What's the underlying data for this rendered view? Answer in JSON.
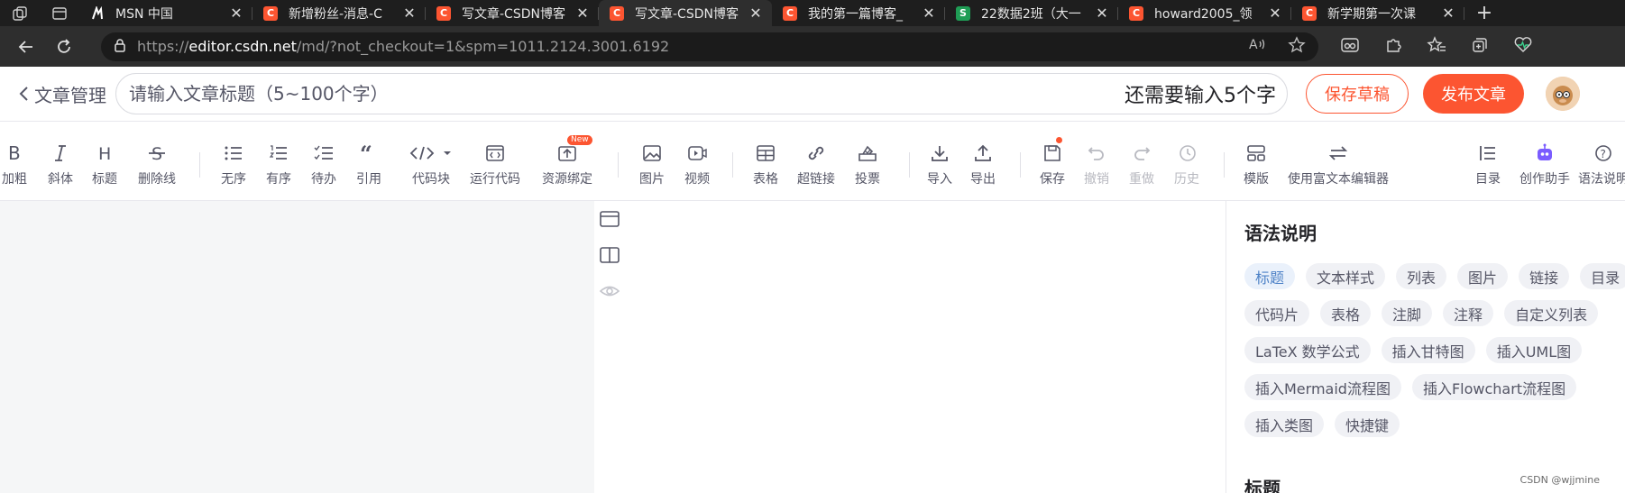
{
  "browser": {
    "tabs": [
      {
        "favicon": "msn",
        "title": "MSN 中国"
      },
      {
        "favicon": "csdn",
        "title": "新增粉丝-消息-C"
      },
      {
        "favicon": "csdn",
        "title": "写文章-CSDN博客"
      },
      {
        "favicon": "csdn",
        "title": "写文章-CSDN博客",
        "active": true
      },
      {
        "favicon": "csdn",
        "title": "我的第一篇博客_"
      },
      {
        "favicon": "sheets",
        "title": "22数据2班（大一"
      },
      {
        "favicon": "csdn",
        "title": "howard2005_领"
      },
      {
        "favicon": "csdn",
        "title": "新学期第一次课"
      }
    ],
    "url_host": "editor.csdn.net",
    "url_prefix": "https://",
    "url_path": "/md/?not_checkout=1&spm=1011.2124.3001.6192"
  },
  "header": {
    "back_label": "文章管理",
    "title_placeholder": "请输入文章标题（5~100个字）",
    "title_counter": "还需要输入5个字",
    "save_draft": "保存草稿",
    "publish": "发布文章"
  },
  "toolbar": {
    "bold": "加粗",
    "italic": "斜体",
    "heading": "标题",
    "strike": "删除线",
    "ul": "无序",
    "ol": "有序",
    "todo": "待办",
    "quote": "引用",
    "codeblock": "代码块",
    "run_code": "运行代码",
    "resource": "资源绑定",
    "new_badge": "New",
    "image": "图片",
    "video": "视频",
    "table": "表格",
    "link": "超链接",
    "vote": "投票",
    "import": "导入",
    "export": "导出",
    "save": "保存",
    "undo": "撤销",
    "redo": "重做",
    "history": "历史",
    "template": "模版",
    "rich_text": "使用富文本编辑器",
    "toc": "目录",
    "assistant": "创作助手",
    "syntax": "语法说明"
  },
  "sidebar": {
    "title": "语法说明",
    "tags": [
      "标题",
      "文本样式",
      "列表",
      "图片",
      "链接",
      "目录",
      "代码片",
      "表格",
      "注脚",
      "注释",
      "自定义列表",
      "LaTeX 数学公式",
      "插入甘特图",
      "插入UML图",
      "插入Mermaid流程图",
      "插入Flowchart流程图",
      "插入类图",
      "快捷键"
    ],
    "section_heading": "标题"
  },
  "watermark": "CSDN @wjjmine"
}
